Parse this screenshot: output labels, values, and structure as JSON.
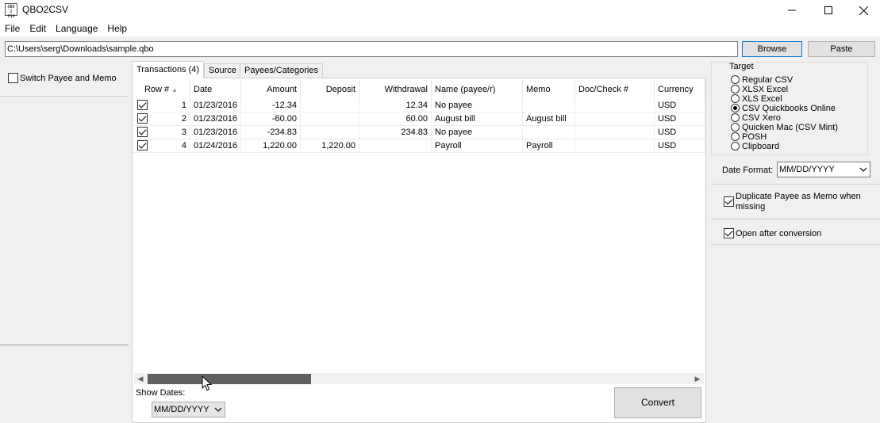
{
  "window": {
    "title": "QBO2CSV",
    "icon_text": "QBO2CSV"
  },
  "menu": [
    "File",
    "Edit",
    "Language",
    "Help"
  ],
  "path": {
    "value": "C:\\Users\\serg\\Downloads\\sample.qbo",
    "browse_label": "Browse",
    "paste_label": "Paste"
  },
  "left_panel": {
    "switch_label": "Switch Payee and Memo",
    "switch_checked": false
  },
  "tabs": [
    {
      "label": "Transactions (4)",
      "active": true
    },
    {
      "label": "Source",
      "active": false
    },
    {
      "label": "Payees/Categories",
      "active": false
    }
  ],
  "grid": {
    "columns": [
      "Row #",
      "Date",
      "Amount",
      "Deposit",
      "Withdrawal",
      "Name (payee/r)",
      "Memo",
      "Doc/Check #",
      "Currency"
    ],
    "rows": [
      {
        "checked": true,
        "row": "1",
        "date": "01/23/2016",
        "amount": "-12.34",
        "deposit": "",
        "withdrawal": "12.34",
        "name": "No payee",
        "memo": "",
        "doc": "",
        "currency": "USD"
      },
      {
        "checked": true,
        "row": "2",
        "date": "01/23/2016",
        "amount": "-60.00",
        "deposit": "",
        "withdrawal": "60.00",
        "name": "August bill",
        "memo": "August bill",
        "doc": "",
        "currency": "USD"
      },
      {
        "checked": true,
        "row": "3",
        "date": "01/23/2016",
        "amount": "-234.83",
        "deposit": "",
        "withdrawal": "234.83",
        "name": "No payee",
        "memo": "",
        "doc": "",
        "currency": "USD"
      },
      {
        "checked": true,
        "row": "4",
        "date": "01/24/2016",
        "amount": "1,220.00",
        "deposit": "1,220.00",
        "withdrawal": "",
        "name": "Payroll",
        "memo": "Payroll",
        "doc": "",
        "currency": "USD"
      }
    ]
  },
  "show_dates": {
    "label": "Show Dates:",
    "value": "MM/DD/YYYY"
  },
  "convert_label": "Convert",
  "target": {
    "title": "Target",
    "options": [
      {
        "label": "Regular CSV",
        "selected": false
      },
      {
        "label": "XLSX Excel",
        "selected": false
      },
      {
        "label": "XLS Excel",
        "selected": false
      },
      {
        "label": "CSV Quickbooks Online",
        "selected": true
      },
      {
        "label": "CSV Xero",
        "selected": false
      },
      {
        "label": "Quicken Mac (CSV Mint)",
        "selected": false
      },
      {
        "label": "POSH",
        "selected": false
      },
      {
        "label": "Clipboard",
        "selected": false
      }
    ]
  },
  "date_format": {
    "label": "Date Format:",
    "value": "MM/DD/YYYY"
  },
  "options": {
    "duplicate_label": "Duplicate Payee as Memo when missing",
    "duplicate_checked": true,
    "open_after_label": "Open after conversion",
    "open_after_checked": true
  },
  "colors": {
    "accent_border": "#0078d7",
    "scroll_thumb": "#606060"
  }
}
